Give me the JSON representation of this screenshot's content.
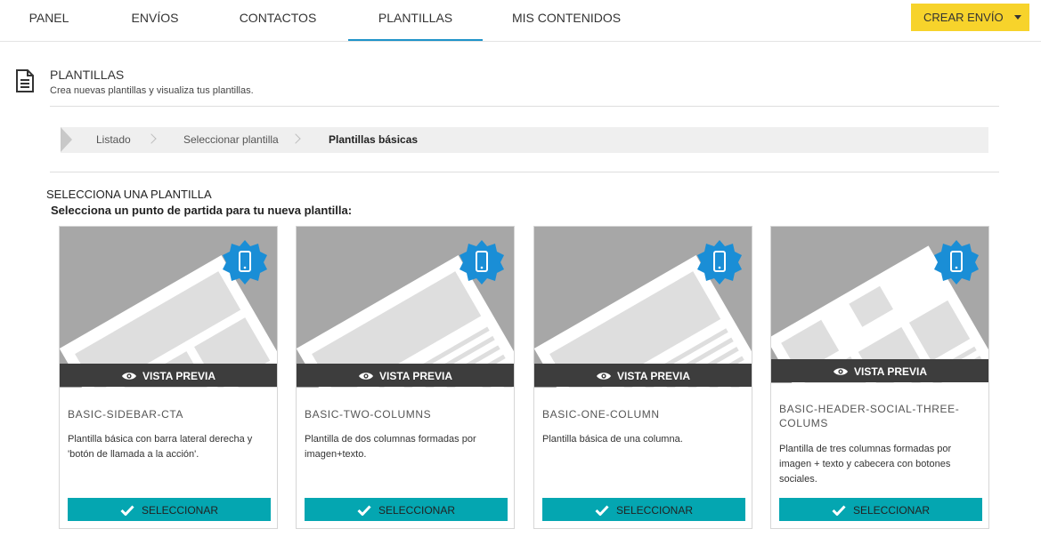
{
  "nav": {
    "tabs": [
      {
        "label": "PANEL"
      },
      {
        "label": "ENVÍOS"
      },
      {
        "label": "CONTACTOS"
      },
      {
        "label": "PLANTILLAS",
        "active": true
      },
      {
        "label": "MIS CONTENIDOS"
      }
    ],
    "create_button": "CREAR ENVÍO"
  },
  "header": {
    "title": "PLANTILLAS",
    "subtitle": "Crea nuevas plantillas y visualiza tus plantillas."
  },
  "breadcrumb": [
    "Listado",
    "Seleccionar plantilla",
    "Plantillas básicas"
  ],
  "section": {
    "title": "SELECCIONA UNA PLANTILLA",
    "subtitle": "Selecciona un punto de partida para tu nueva plantilla:"
  },
  "cards": [
    {
      "name": "BASIC-SIDEBAR-CTA",
      "description": "Plantilla básica con barra lateral derecha y 'botón de llamada a la acción'.",
      "preview_label": "VISTA PREVIA",
      "select_label": "SELECCIONAR"
    },
    {
      "name": "BASIC-TWO-COLUMNS",
      "description": "Plantilla de dos columnas formadas por imagen+texto.",
      "preview_label": "VISTA PREVIA",
      "select_label": "SELECCIONAR"
    },
    {
      "name": "BASIC-ONE-COLUMN",
      "description": "Plantilla básica de una columna.",
      "preview_label": "VISTA PREVIA",
      "select_label": "SELECCIONAR"
    },
    {
      "name": "BASIC-HEADER-SOCIAL-THREE-COLUMS",
      "description": "Plantilla de tres columnas formadas por imagen + texto y cabecera con botones sociales.",
      "preview_label": "VISTA PREVIA",
      "select_label": "SELECCIONAR"
    }
  ],
  "colors": {
    "accent_yellow": "#f7d32b",
    "teal_button": "#04a6b1",
    "badge_blue": "#1a8ed6",
    "active_tab_underline": "#1e93c9"
  },
  "icons": {
    "header": "document-icon",
    "badge": "mobile-responsive-badge-icon",
    "preview": "eye-icon",
    "select": "check-icon"
  }
}
